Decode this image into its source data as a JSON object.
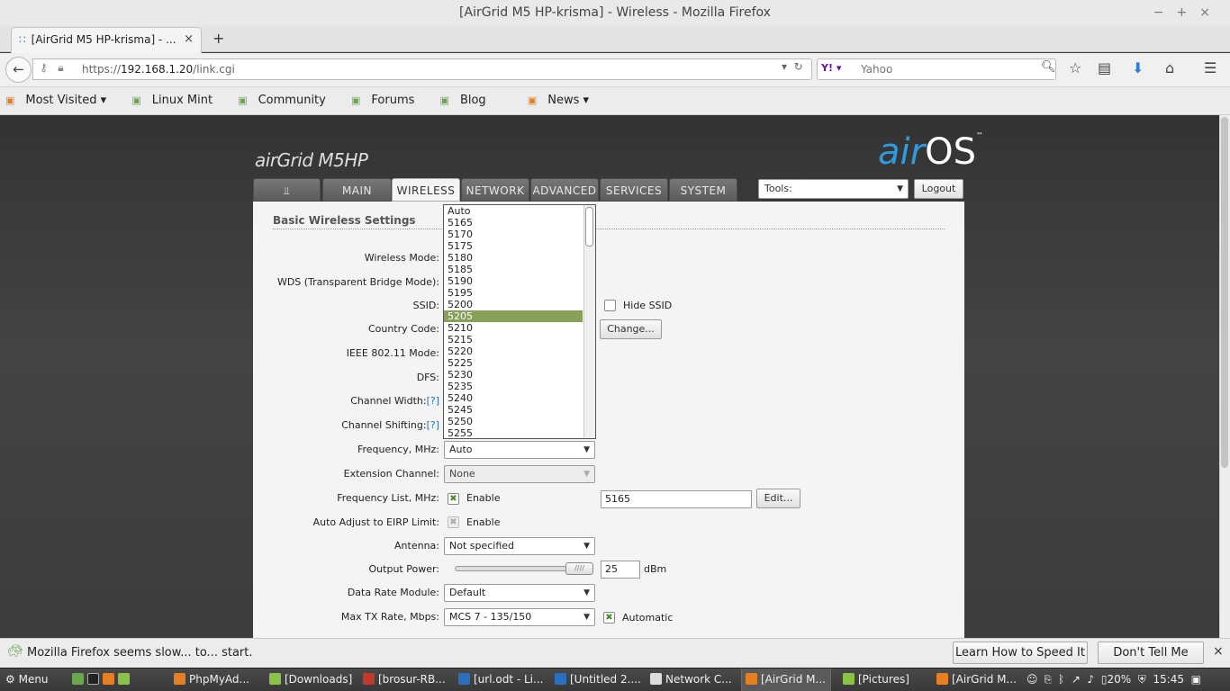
{
  "window": {
    "title": "[AirGrid M5 HP-krisma] - Wireless - Mozilla Firefox",
    "controls": "−+×"
  },
  "browser": {
    "tab_title": "[AirGrid M5 HP-krisma] - ...",
    "tab_close": "×",
    "new_tab": "+",
    "url_prefix": "https://",
    "url_host": "192.168.1.20",
    "url_path": "/link.cgi",
    "search_placeholder": "Yahoo",
    "search_engine_badge": "Y!",
    "bookmarks": [
      {
        "label": "Most Visited ▾"
      },
      {
        "label": "Linux Mint"
      },
      {
        "label": "Community"
      },
      {
        "label": "Forums"
      },
      {
        "label": "Blog"
      },
      {
        "label": "News ▾"
      }
    ]
  },
  "airos": {
    "product_logo": "airGrid M5HP",
    "os_logo_air": "air",
    "os_logo_os": "OS",
    "os_logo_tm": "™",
    "tabs": [
      "MAIN",
      "WIRELESS",
      "NETWORK",
      "ADVANCED",
      "SERVICES",
      "SYSTEM"
    ],
    "active_tab": "WIRELESS",
    "tools_label": "Tools:",
    "logout_label": "Logout"
  },
  "form": {
    "section_title": "Basic Wireless Settings",
    "labels": {
      "wireless_mode": "Wireless Mode:",
      "wds": "WDS (Transparent Bridge Mode):",
      "ssid": "SSID:",
      "country_code": "Country Code:",
      "ieee_mode": "IEEE 802.11 Mode:",
      "dfs": "DFS:",
      "channel_width": "Channel Width:",
      "channel_shifting": "Channel Shifting:",
      "help": "[?]",
      "frequency": "Frequency, MHz:",
      "extension_channel": "Extension Channel:",
      "frequency_list": "Frequency List, MHz:",
      "auto_adjust_eirp": "Auto Adjust to EIRP Limit:",
      "antenna": "Antenna:",
      "output_power": "Output Power:",
      "data_rate_module": "Data Rate Module:",
      "max_tx_rate": "Max TX Rate, Mbps:"
    },
    "hide_ssid_label": "Hide SSID",
    "change_button": "Change...",
    "frequency_value": "Auto",
    "extension_channel_value": "None",
    "enable_label": "Enable",
    "frequency_list_value": "5165",
    "edit_button": "Edit...",
    "antenna_value": "Not specified",
    "output_power_value": "25",
    "output_power_unit": "dBm",
    "data_rate_module_value": "Default",
    "max_tx_rate_value": "MCS 7 - 135/150",
    "automatic_label": "Automatic",
    "frequency_options": [
      "Auto",
      "5165",
      "5170",
      "5175",
      "5180",
      "5185",
      "5190",
      "5195",
      "5200",
      "5205",
      "5210",
      "5215",
      "5220",
      "5225",
      "5230",
      "5235",
      "5240",
      "5245",
      "5250",
      "5255"
    ],
    "highlighted_option": "5205"
  },
  "notification": {
    "message": "Mozilla Firefox seems slow... to... start.",
    "learn_button": "Learn How to Speed It Up",
    "dismiss_button": "Don't Tell Me Again",
    "close": "×"
  },
  "taskbar": {
    "menu_label": "Menu",
    "items": [
      {
        "label": "PhpMyAd..."
      },
      {
        "label": "[Downloads]"
      },
      {
        "label": "[brosur-RB..."
      },
      {
        "label": "[url.odt - Li..."
      },
      {
        "label": "[Untitled 2...."
      },
      {
        "label": "Network C..."
      },
      {
        "label": "[AirGrid M..."
      },
      {
        "label": "[Pictures]"
      },
      {
        "label": "[AirGrid M..."
      }
    ],
    "battery": "20%",
    "clock": "15:45"
  }
}
